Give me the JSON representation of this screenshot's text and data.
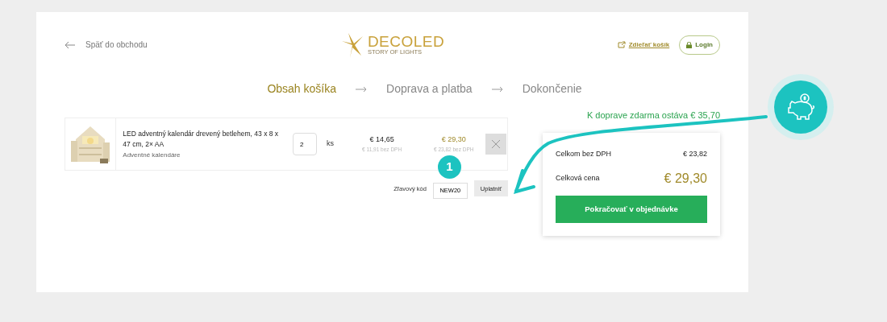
{
  "header": {
    "back_link": "Späť do obchodu",
    "logo": {
      "name": "DECOLED",
      "tagline": "STORY OF LIGHTS"
    },
    "share_link": "Zdieľať košík",
    "login_button": "Login"
  },
  "steps": [
    {
      "label": "Obsah košíka",
      "selected": true
    },
    {
      "label": "Doprava a platba",
      "selected": false
    },
    {
      "label": "Dokončenie",
      "selected": false
    }
  ],
  "cart_items": [
    {
      "name": "LED adventný kalendár drevený betlehem, 43 x 8 x 47 cm, 2× AA",
      "category": "Adventné kalendáre",
      "quantity": "2",
      "unit": "ks",
      "unit_price": "€ 14,65",
      "unit_price_net": "€ 11,91 bez DPH",
      "total_price": "€ 29,30",
      "total_price_net": "€ 23,82 bez DPH"
    }
  ],
  "discount": {
    "label": "Zľavový kód",
    "value": "NEW20",
    "button": "Uplatniť",
    "step_badge": "1"
  },
  "free_shipping": "K doprave zdarma ostáva € 35,70",
  "summary": {
    "net_label": "Celkom bez DPH",
    "net_value": "€ 23,82",
    "total_label": "Celková cena",
    "total_value": "€ 29,30",
    "checkout_button": "Pokračovať v objednávke"
  }
}
